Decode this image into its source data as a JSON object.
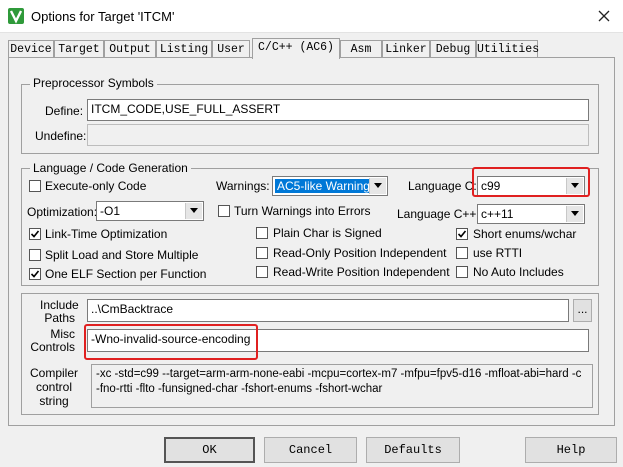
{
  "window": {
    "title": "Options for Target 'ITCM'"
  },
  "tabs": [
    {
      "label": "Device"
    },
    {
      "label": "Target"
    },
    {
      "label": "Output"
    },
    {
      "label": "Listing"
    },
    {
      "label": "User"
    },
    {
      "label": "C/C++ (AC6)",
      "active": true
    },
    {
      "label": "Asm"
    },
    {
      "label": "Linker"
    },
    {
      "label": "Debug"
    },
    {
      "label": "Utilities"
    }
  ],
  "preprocessor": {
    "legend": "Preprocessor Symbols",
    "define_label": "Define:",
    "define_value": "ITCM_CODE,USE_FULL_ASSERT",
    "undefine_label": "Undefine:",
    "undefine_value": ""
  },
  "language": {
    "legend": "Language / Code Generation",
    "execute_only": {
      "label": "Execute-only Code",
      "checked": false
    },
    "warnings_label": "Warnings:",
    "warnings_value": "AC5-like Warnings",
    "language_c_label": "Language C:",
    "language_c_value": "c99",
    "optimization_label": "Optimization:",
    "optimization_value": "-O1",
    "turn_warnings": {
      "label": "Turn Warnings into Errors",
      "checked": false
    },
    "language_cpp_label": "Language C++:",
    "language_cpp_value": "c++11",
    "link_time": {
      "label": "Link-Time Optimization",
      "checked": true
    },
    "plain_char": {
      "label": "Plain Char is Signed",
      "checked": false
    },
    "short_enums": {
      "label": "Short enums/wchar",
      "checked": true
    },
    "split_load": {
      "label": "Split Load and Store Multiple",
      "checked": false
    },
    "ro_pi": {
      "label": "Read-Only Position Independent",
      "checked": false
    },
    "use_rtti": {
      "label": "use RTTI",
      "checked": false
    },
    "one_elf": {
      "label": "One ELF Section per Function",
      "checked": true
    },
    "rw_pi": {
      "label": "Read-Write Position Independent",
      "checked": false
    },
    "no_auto_includes": {
      "label": "No Auto Includes",
      "checked": false
    }
  },
  "paths": {
    "include_label_1": "Include",
    "include_label_2": "Paths",
    "include_value": "..\\CmBacktrace",
    "browse_label": "...",
    "misc_label_1": "Misc",
    "misc_label_2": "Controls",
    "misc_value": "-Wno-invalid-source-encoding",
    "compiler_label_1": "Compiler",
    "compiler_label_2": "control",
    "compiler_label_3": "string",
    "compiler_line_1": "-xc -std=c99 --target=arm-arm-none-eabi -mcpu=cortex-m7 -mfpu=fpv5-d16 -mfloat-abi=hard -c",
    "compiler_line_2": "-fno-rtti -flto -funsigned-char -fshort-enums -fshort-wchar"
  },
  "buttons": {
    "ok": "OK",
    "cancel": "Cancel",
    "defaults": "Defaults",
    "help": "Help"
  },
  "colors": {
    "highlight": "#e02020",
    "selection": "#0078d7"
  }
}
